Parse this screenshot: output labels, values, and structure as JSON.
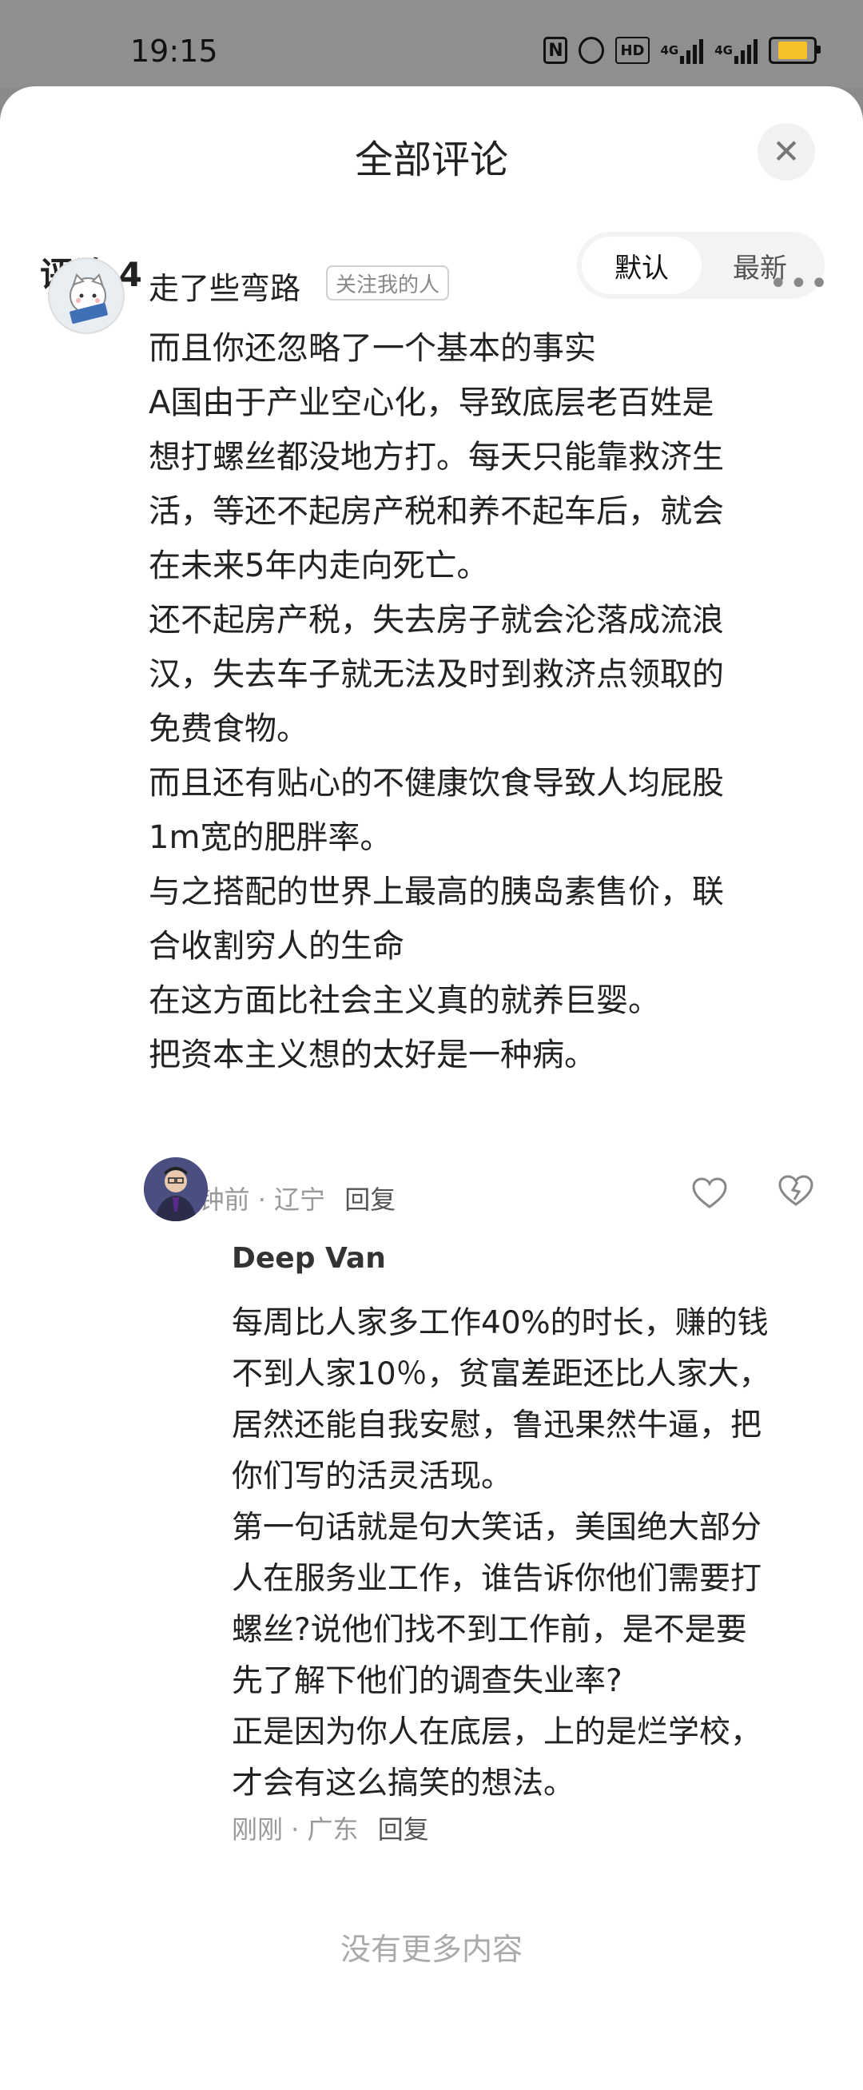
{
  "status_bar": {
    "time": "19:15",
    "icons": [
      "nfc-icon",
      "alarm-icon",
      "hd-icon",
      "signal-4g-icon",
      "signal-4g-icon",
      "battery-icon"
    ],
    "net1": "4G",
    "net2": "4G",
    "hd_label": "HD",
    "nfc_label": "N",
    "battery_color": "#f5c126"
  },
  "sheet": {
    "title": "全部评论",
    "close_label": "✕"
  },
  "comments_header": {
    "count_label": "评论 4",
    "sort_options": [
      "默认",
      "最新"
    ],
    "selected_sort": "默认"
  },
  "comment": {
    "author": "走了些弯路",
    "tag": "关注我的人",
    "more": "•••",
    "lines": [
      "而且你还忽略了一个基本的事实",
      "A国由于产业空心化，导致底层老百姓是",
      "想打螺丝都没地方打。每天只能靠救济生",
      "活，等还不起房产税和养不起车后，就会",
      "在未来5年内走向死亡。",
      "还不起房产税，失去房子就会沦落成流浪",
      "汉，失去车子就无法及时到救济点领取的",
      "免费食物。",
      "而且还有贴心的不健康饮食导致人均屁股",
      "1m宽的肥胖率。",
      "与之搭配的世界上最高的胰岛素售价，联",
      "合收割穷人的生命",
      "在这方面比社会主义真的就养巨婴。",
      "把资本主义想的太好是一种病。"
    ],
    "time_location": "6 分钟前 · 辽宁",
    "reply_label": "回复"
  },
  "reply": {
    "author": "Deep Van",
    "lines": [
      "每周比人家多工作40%的时长，赚的钱",
      "不到人家10％，贫富差距还比人家大，",
      "居然还能自我安慰，鲁迅果然牛逼，把",
      "你们写的活灵活现。",
      "第一句话就是句大笑话，美国绝大部分",
      "人在服务业工作，谁告诉你他们需要打",
      "螺丝?说他们找不到工作前，是不是要",
      "先了解下他们的调查失业率?",
      "正是因为你人在底层，上的是烂学校，",
      "才会有这么搞笑的想法。"
    ],
    "time_location": "刚刚 · 广东",
    "reply_label": "回复"
  },
  "footer": {
    "no_more": "没有更多内容"
  }
}
